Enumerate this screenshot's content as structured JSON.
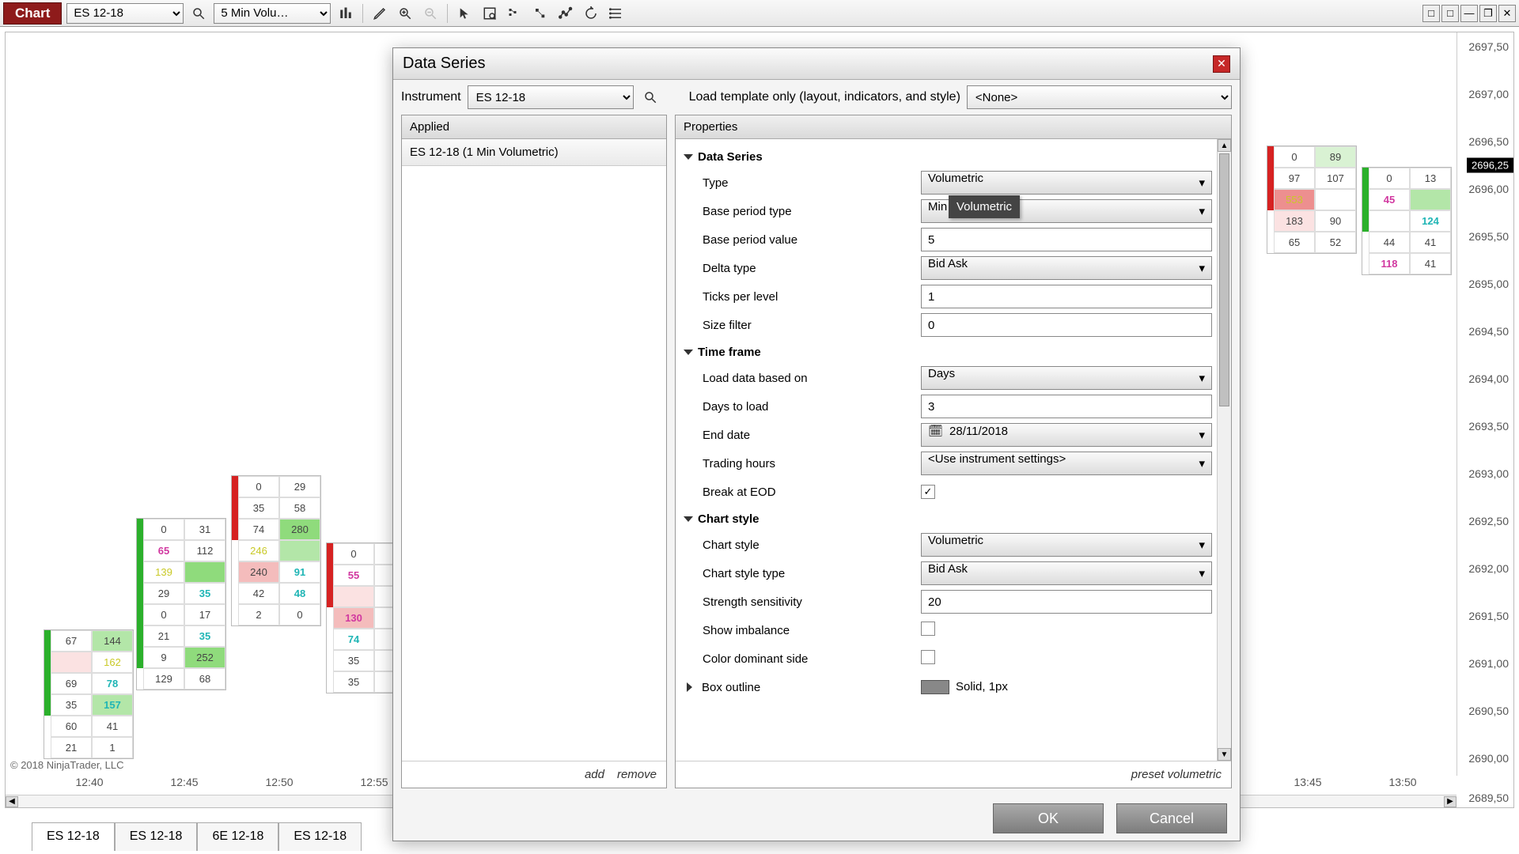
{
  "toolbar": {
    "badge": "Chart",
    "instrument": "ES 12-18",
    "timeframe": "5 Min Volu…"
  },
  "window": {
    "minimize": "—",
    "restore": "❐",
    "close": "✕",
    "sq1": "□",
    "sq2": "□"
  },
  "copyright": "© 2018 NinjaTrader, LLC",
  "xaxis": [
    "12:40",
    "12:45",
    "12:50",
    "12:55",
    "13:45",
    "13:50"
  ],
  "yaxis": [
    "2697,50",
    "2697,00",
    "2696,50",
    "2696,25",
    "2696,00",
    "2695,50",
    "2695,00",
    "2694,50",
    "2694,00",
    "2693,50",
    "2693,00",
    "2692,50",
    "2692,00",
    "2691,50",
    "2691,00",
    "2690,50",
    "2690,00",
    "2689,50"
  ],
  "price_tag": "2696,25",
  "tabs": [
    "ES 12-18",
    "ES 12-18",
    "6E 12-18",
    "ES 12-18"
  ],
  "ladders": {
    "l1": [
      [
        "67",
        "144"
      ],
      [
        "",
        "162"
      ],
      [
        "69",
        "78"
      ],
      [
        "35",
        "157"
      ],
      [
        "60",
        "41"
      ],
      [
        "21",
        "1"
      ]
    ],
    "l2": [
      [
        "0",
        "31"
      ],
      [
        "65",
        "112"
      ],
      [
        "139",
        ""
      ],
      [
        "29",
        "35"
      ],
      [
        "0",
        "17"
      ],
      [
        "21",
        "35"
      ],
      [
        "9",
        "252"
      ],
      [
        "129",
        "68"
      ]
    ],
    "l3": [
      [
        "0",
        "29"
      ],
      [
        "35",
        "58"
      ],
      [
        "74",
        "280"
      ],
      [
        "246",
        ""
      ],
      [
        "240",
        "91"
      ],
      [
        "42",
        "48"
      ],
      [
        "2",
        "0"
      ]
    ],
    "l4": [
      [
        "0",
        ""
      ],
      [
        "55",
        ""
      ],
      [
        "",
        ""
      ],
      [
        "130",
        ""
      ],
      [
        "74",
        ""
      ],
      [
        "35",
        ""
      ],
      [
        "35",
        ""
      ]
    ],
    "r1": [
      [
        "0",
        "89"
      ],
      [
        "97",
        "107"
      ],
      [
        "553",
        ""
      ],
      [
        "183",
        "90"
      ],
      [
        "65",
        "52"
      ]
    ],
    "r2": [
      [
        "0",
        "13"
      ],
      [
        "45",
        ""
      ],
      [
        "",
        "124"
      ],
      [
        "44",
        "41"
      ],
      [
        "118",
        "41"
      ]
    ]
  },
  "dialog": {
    "title": "Data Series",
    "instrument_label": "Instrument",
    "instrument": "ES 12-18",
    "template_label": "Load template only (layout, indicators, and style)",
    "template": "<None>",
    "applied_header": "Applied",
    "applied_item": "ES 12-18 (1 Min Volumetric)",
    "properties_header": "Properties",
    "footer_left": {
      "add": "add",
      "remove": "remove"
    },
    "footer_right": "preset volumetric",
    "tooltip": "Volumetric",
    "sections": {
      "data_series": "Data Series",
      "time_frame": "Time frame",
      "chart_style": "Chart style",
      "box_outline": "Box outline"
    },
    "props": {
      "type_label": "Type",
      "type": "Volumetric",
      "bpt_label": "Base period type",
      "bpt": "Min",
      "bpv_label": "Base period value",
      "bpv": "5",
      "delta_label": "Delta type",
      "delta": "Bid Ask",
      "tpl_label": "Ticks per level",
      "tpl": "1",
      "sf_label": "Size filter",
      "sf": "0",
      "ldbo_label": "Load data based on",
      "ldbo": "Days",
      "dtl_label": "Days to load",
      "dtl": "3",
      "ed_label": "End date",
      "ed": "28/11/2018",
      "th_label": "Trading hours",
      "th": "<Use instrument settings>",
      "beod_label": "Break at EOD",
      "beod": true,
      "cs_label": "Chart style",
      "cs": "Volumetric",
      "cst_label": "Chart style type",
      "cst": "Bid Ask",
      "ss_label": "Strength sensitivity",
      "ss": "20",
      "si_label": "Show imbalance",
      "si": false,
      "cds_label": "Color dominant side",
      "cds": false,
      "box_outline_val": "Solid, 1px"
    },
    "ok": "OK",
    "cancel": "Cancel"
  }
}
